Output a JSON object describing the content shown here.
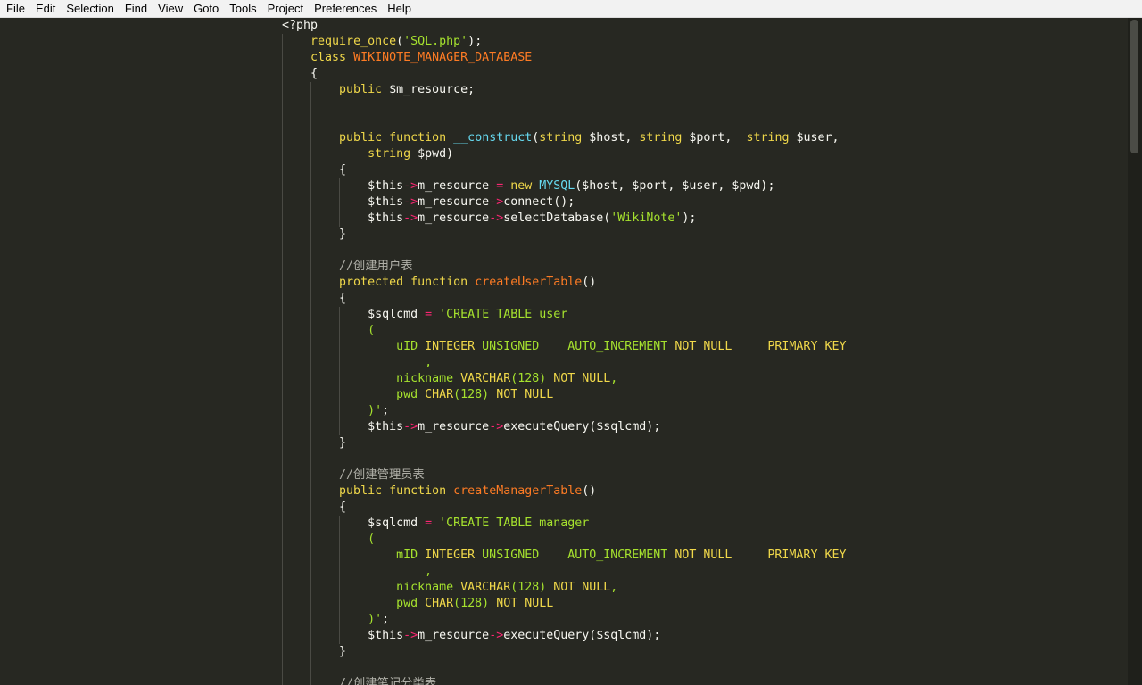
{
  "menu": [
    "File",
    "Edit",
    "Selection",
    "Find",
    "View",
    "Goto",
    "Tools",
    "Project",
    "Preferences",
    "Help"
  ],
  "code_lines": [
    {
      "indent": 0,
      "guides": 0,
      "tokens": [
        {
          "t": "<?php",
          "c": ""
        }
      ]
    },
    {
      "indent": 1,
      "guides": 1,
      "tokens": [
        {
          "t": "require_once",
          "c": "kw"
        },
        {
          "t": "(",
          "c": ""
        },
        {
          "t": "'SQL.php'",
          "c": "str"
        },
        {
          "t": ");",
          "c": ""
        }
      ]
    },
    {
      "indent": 1,
      "guides": 1,
      "tokens": [
        {
          "t": "class",
          "c": "kw"
        },
        {
          "t": " ",
          "c": ""
        },
        {
          "t": "WIKINOTE_MANAGER_DATABASE",
          "c": "cls"
        }
      ]
    },
    {
      "indent": 1,
      "guides": 1,
      "tokens": [
        {
          "t": "{",
          "c": ""
        }
      ]
    },
    {
      "indent": 2,
      "guides": 2,
      "tokens": [
        {
          "t": "public",
          "c": "kw"
        },
        {
          "t": " $m_resource;",
          "c": ""
        }
      ]
    },
    {
      "indent": 0,
      "guides": 2,
      "tokens": []
    },
    {
      "indent": 0,
      "guides": 2,
      "tokens": []
    },
    {
      "indent": 2,
      "guides": 2,
      "tokens": [
        {
          "t": "public",
          "c": "kw"
        },
        {
          "t": " ",
          "c": ""
        },
        {
          "t": "function",
          "c": "kw"
        },
        {
          "t": " ",
          "c": ""
        },
        {
          "t": "__construct",
          "c": "bi"
        },
        {
          "t": "(",
          "c": ""
        },
        {
          "t": "string",
          "c": "kw"
        },
        {
          "t": " $host, ",
          "c": ""
        },
        {
          "t": "string",
          "c": "kw"
        },
        {
          "t": " $port,  ",
          "c": ""
        },
        {
          "t": "string",
          "c": "kw"
        },
        {
          "t": " $user,",
          "c": ""
        }
      ]
    },
    {
      "indent": 3,
      "guides": 2,
      "tokens": [
        {
          "t": "string",
          "c": "kw"
        },
        {
          "t": " $pwd)",
          "c": ""
        }
      ]
    },
    {
      "indent": 2,
      "guides": 2,
      "tokens": [
        {
          "t": "{",
          "c": ""
        }
      ]
    },
    {
      "indent": 3,
      "guides": 3,
      "tokens": [
        {
          "t": "$this",
          "c": ""
        },
        {
          "t": "->",
          "c": "op"
        },
        {
          "t": "m_resource ",
          "c": ""
        },
        {
          "t": "=",
          "c": "op"
        },
        {
          "t": " ",
          "c": ""
        },
        {
          "t": "new",
          "c": "kw"
        },
        {
          "t": " ",
          "c": ""
        },
        {
          "t": "MYSQL",
          "c": "bi"
        },
        {
          "t": "($host, $port, $user, $pwd);",
          "c": ""
        }
      ]
    },
    {
      "indent": 3,
      "guides": 3,
      "tokens": [
        {
          "t": "$this",
          "c": ""
        },
        {
          "t": "->",
          "c": "op"
        },
        {
          "t": "m_resource",
          "c": ""
        },
        {
          "t": "->",
          "c": "op"
        },
        {
          "t": "connect();",
          "c": ""
        }
      ]
    },
    {
      "indent": 3,
      "guides": 3,
      "tokens": [
        {
          "t": "$this",
          "c": ""
        },
        {
          "t": "->",
          "c": "op"
        },
        {
          "t": "m_resource",
          "c": ""
        },
        {
          "t": "->",
          "c": "op"
        },
        {
          "t": "selectDatabase(",
          "c": ""
        },
        {
          "t": "'WikiNote'",
          "c": "str"
        },
        {
          "t": ");",
          "c": ""
        }
      ]
    },
    {
      "indent": 2,
      "guides": 2,
      "tokens": [
        {
          "t": "}",
          "c": ""
        }
      ]
    },
    {
      "indent": 0,
      "guides": 2,
      "tokens": []
    },
    {
      "indent": 2,
      "guides": 2,
      "tokens": [
        {
          "t": "//创建用户表",
          "c": "cmt"
        }
      ]
    },
    {
      "indent": 2,
      "guides": 2,
      "tokens": [
        {
          "t": "protected",
          "c": "kw"
        },
        {
          "t": " ",
          "c": ""
        },
        {
          "t": "function",
          "c": "kw"
        },
        {
          "t": " ",
          "c": ""
        },
        {
          "t": "createUserTable",
          "c": "fn"
        },
        {
          "t": "()",
          "c": ""
        }
      ]
    },
    {
      "indent": 2,
      "guides": 2,
      "tokens": [
        {
          "t": "{",
          "c": ""
        }
      ]
    },
    {
      "indent": 3,
      "guides": 3,
      "tokens": [
        {
          "t": "$sqlcmd ",
          "c": ""
        },
        {
          "t": "=",
          "c": "op"
        },
        {
          "t": " ",
          "c": ""
        },
        {
          "t": "'CREATE TABLE user",
          "c": "str"
        }
      ]
    },
    {
      "indent": 3,
      "guides": 3,
      "tokens": [
        {
          "t": "(",
          "c": "str"
        }
      ]
    },
    {
      "indent": 4,
      "guides": 4,
      "tokens": [
        {
          "t": "uID ",
          "c": "str"
        },
        {
          "t": "INTEGER",
          "c": "kw"
        },
        {
          "t": " UNSIGNED    AUTO_INCREMENT ",
          "c": "str"
        },
        {
          "t": "NOT NULL",
          "c": "kw"
        },
        {
          "t": "     ",
          "c": "str"
        },
        {
          "t": "PRIMARY KEY",
          "c": "kw"
        }
      ]
    },
    {
      "indent": 5,
      "guides": 4,
      "tokens": [
        {
          "t": ",",
          "c": "str"
        }
      ]
    },
    {
      "indent": 4,
      "guides": 4,
      "tokens": [
        {
          "t": "nickname ",
          "c": "str"
        },
        {
          "t": "VARCHAR",
          "c": "kw"
        },
        {
          "t": "(128) ",
          "c": "str"
        },
        {
          "t": "NOT NULL",
          "c": "kw"
        },
        {
          "t": ",",
          "c": "str"
        }
      ]
    },
    {
      "indent": 4,
      "guides": 4,
      "tokens": [
        {
          "t": "pwd ",
          "c": "str"
        },
        {
          "t": "CHAR",
          "c": "kw"
        },
        {
          "t": "(128) ",
          "c": "str"
        },
        {
          "t": "NOT NULL",
          "c": "kw"
        }
      ]
    },
    {
      "indent": 3,
      "guides": 3,
      "tokens": [
        {
          "t": ")'",
          "c": "str"
        },
        {
          "t": ";",
          "c": ""
        }
      ]
    },
    {
      "indent": 3,
      "guides": 3,
      "tokens": [
        {
          "t": "$this",
          "c": ""
        },
        {
          "t": "->",
          "c": "op"
        },
        {
          "t": "m_resource",
          "c": ""
        },
        {
          "t": "->",
          "c": "op"
        },
        {
          "t": "executeQuery($sqlcmd);",
          "c": ""
        }
      ]
    },
    {
      "indent": 2,
      "guides": 2,
      "tokens": [
        {
          "t": "}",
          "c": ""
        }
      ]
    },
    {
      "indent": 0,
      "guides": 2,
      "tokens": []
    },
    {
      "indent": 2,
      "guides": 2,
      "tokens": [
        {
          "t": "//创建管理员表",
          "c": "cmt"
        }
      ]
    },
    {
      "indent": 2,
      "guides": 2,
      "tokens": [
        {
          "t": "public",
          "c": "kw"
        },
        {
          "t": " ",
          "c": ""
        },
        {
          "t": "function",
          "c": "kw"
        },
        {
          "t": " ",
          "c": ""
        },
        {
          "t": "createManagerTable",
          "c": "fn"
        },
        {
          "t": "()",
          "c": ""
        }
      ]
    },
    {
      "indent": 2,
      "guides": 2,
      "tokens": [
        {
          "t": "{",
          "c": ""
        }
      ]
    },
    {
      "indent": 3,
      "guides": 3,
      "tokens": [
        {
          "t": "$sqlcmd ",
          "c": ""
        },
        {
          "t": "=",
          "c": "op"
        },
        {
          "t": " ",
          "c": ""
        },
        {
          "t": "'CREATE TABLE manager",
          "c": "str"
        }
      ]
    },
    {
      "indent": 3,
      "guides": 3,
      "tokens": [
        {
          "t": "(",
          "c": "str"
        }
      ]
    },
    {
      "indent": 4,
      "guides": 4,
      "tokens": [
        {
          "t": "mID ",
          "c": "str"
        },
        {
          "t": "INTEGER",
          "c": "kw"
        },
        {
          "t": " UNSIGNED    AUTO_INCREMENT ",
          "c": "str"
        },
        {
          "t": "NOT NULL",
          "c": "kw"
        },
        {
          "t": "     ",
          "c": "str"
        },
        {
          "t": "PRIMARY KEY",
          "c": "kw"
        }
      ]
    },
    {
      "indent": 5,
      "guides": 4,
      "tokens": [
        {
          "t": ",",
          "c": "str"
        }
      ]
    },
    {
      "indent": 4,
      "guides": 4,
      "tokens": [
        {
          "t": "nickname ",
          "c": "str"
        },
        {
          "t": "VARCHAR",
          "c": "kw"
        },
        {
          "t": "(128) ",
          "c": "str"
        },
        {
          "t": "NOT NULL",
          "c": "kw"
        },
        {
          "t": ",",
          "c": "str"
        }
      ]
    },
    {
      "indent": 4,
      "guides": 4,
      "tokens": [
        {
          "t": "pwd ",
          "c": "str"
        },
        {
          "t": "CHAR",
          "c": "kw"
        },
        {
          "t": "(128) ",
          "c": "str"
        },
        {
          "t": "NOT NULL",
          "c": "kw"
        }
      ]
    },
    {
      "indent": 3,
      "guides": 3,
      "tokens": [
        {
          "t": ")'",
          "c": "str"
        },
        {
          "t": ";",
          "c": ""
        }
      ]
    },
    {
      "indent": 3,
      "guides": 3,
      "tokens": [
        {
          "t": "$this",
          "c": ""
        },
        {
          "t": "->",
          "c": "op"
        },
        {
          "t": "m_resource",
          "c": ""
        },
        {
          "t": "->",
          "c": "op"
        },
        {
          "t": "executeQuery($sqlcmd);",
          "c": ""
        }
      ]
    },
    {
      "indent": 2,
      "guides": 2,
      "tokens": [
        {
          "t": "}",
          "c": ""
        }
      ]
    },
    {
      "indent": 0,
      "guides": 2,
      "tokens": []
    },
    {
      "indent": 2,
      "guides": 2,
      "tokens": [
        {
          "t": "//创建笔记分类表",
          "c": "cmt"
        }
      ]
    }
  ]
}
